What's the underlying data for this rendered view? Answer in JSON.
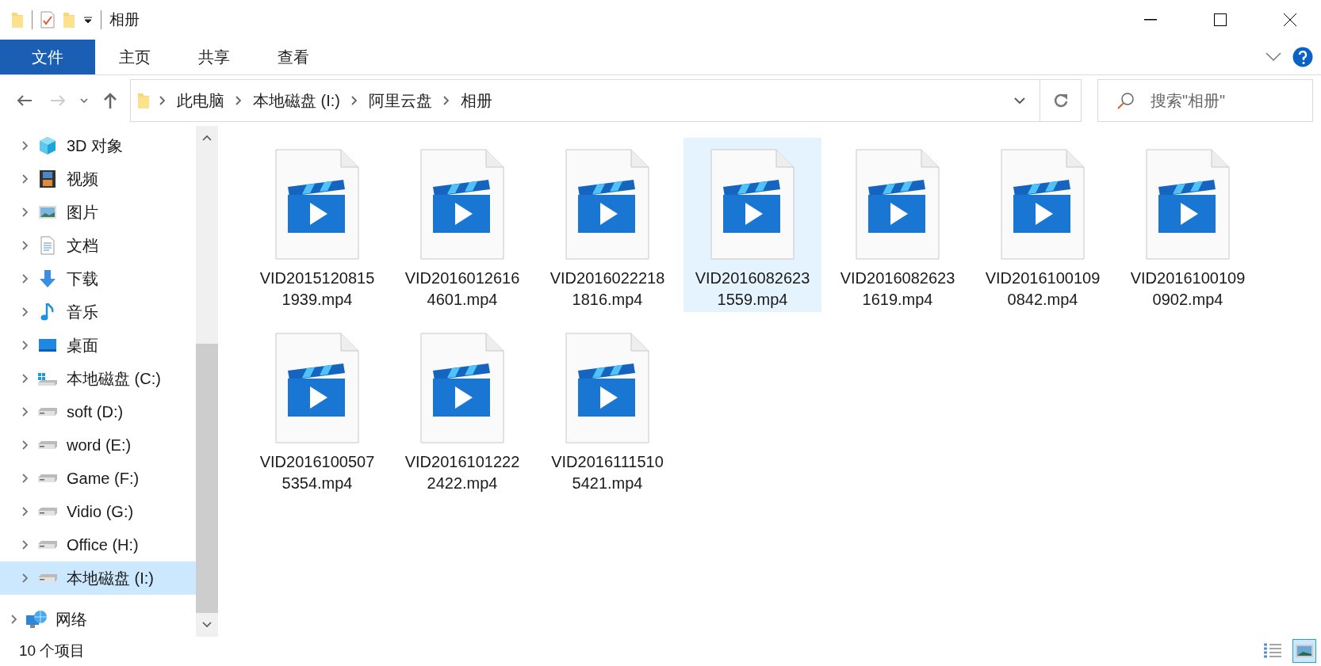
{
  "window": {
    "title": "相册"
  },
  "ribbon_tabs": [
    {
      "label": "文件",
      "kind": "file"
    },
    {
      "label": "主页",
      "kind": "tab"
    },
    {
      "label": "共享",
      "kind": "tab"
    },
    {
      "label": "查看",
      "kind": "tab"
    }
  ],
  "address": {
    "crumbs": [
      "此电脑",
      "本地磁盘 (I:)",
      "阿里云盘",
      "相册"
    ]
  },
  "search": {
    "placeholder": "搜索\"相册\""
  },
  "sidebar": {
    "items": [
      {
        "label": "3D 对象",
        "kind": "cube",
        "selected": false
      },
      {
        "label": "视频",
        "kind": "video",
        "selected": false
      },
      {
        "label": "图片",
        "kind": "pictures",
        "selected": false
      },
      {
        "label": "文档",
        "kind": "documents",
        "selected": false
      },
      {
        "label": "下载",
        "kind": "download",
        "selected": false
      },
      {
        "label": "音乐",
        "kind": "music",
        "selected": false
      },
      {
        "label": "桌面",
        "kind": "desktop",
        "selected": false
      },
      {
        "label": "本地磁盘 (C:)",
        "kind": "systemdrive",
        "selected": false
      },
      {
        "label": "soft (D:)",
        "kind": "drive",
        "selected": false
      },
      {
        "label": "word (E:)",
        "kind": "drive",
        "selected": false
      },
      {
        "label": "Game (F:)",
        "kind": "drive",
        "selected": false
      },
      {
        "label": "Vidio (G:)",
        "kind": "drive",
        "selected": false
      },
      {
        "label": "Office (H:)",
        "kind": "drive",
        "selected": false
      },
      {
        "label": "本地磁盘 (I:)",
        "kind": "drive",
        "selected": true
      }
    ],
    "network": {
      "label": "网络"
    }
  },
  "files": [
    {
      "name": "VID20151208151939.mp4",
      "selected": false
    },
    {
      "name": "VID20160126164601.mp4",
      "selected": false
    },
    {
      "name": "VID20160222181816.mp4",
      "selected": false
    },
    {
      "name": "VID20160826231559.mp4",
      "selected": true
    },
    {
      "name": "VID20160826231619.mp4",
      "selected": false
    },
    {
      "name": "VID20161001090842.mp4",
      "selected": false
    },
    {
      "name": "VID20161001090902.mp4",
      "selected": false
    },
    {
      "name": "VID20161005075354.mp4",
      "selected": false
    },
    {
      "name": "VID20161012222422.mp4",
      "selected": false
    },
    {
      "name": "VID20161115105421.mp4",
      "selected": false
    }
  ],
  "status_bar": {
    "count": "10 个项目",
    "views": [
      {
        "kind": "details",
        "selected": false
      },
      {
        "kind": "large",
        "selected": true
      }
    ]
  }
}
